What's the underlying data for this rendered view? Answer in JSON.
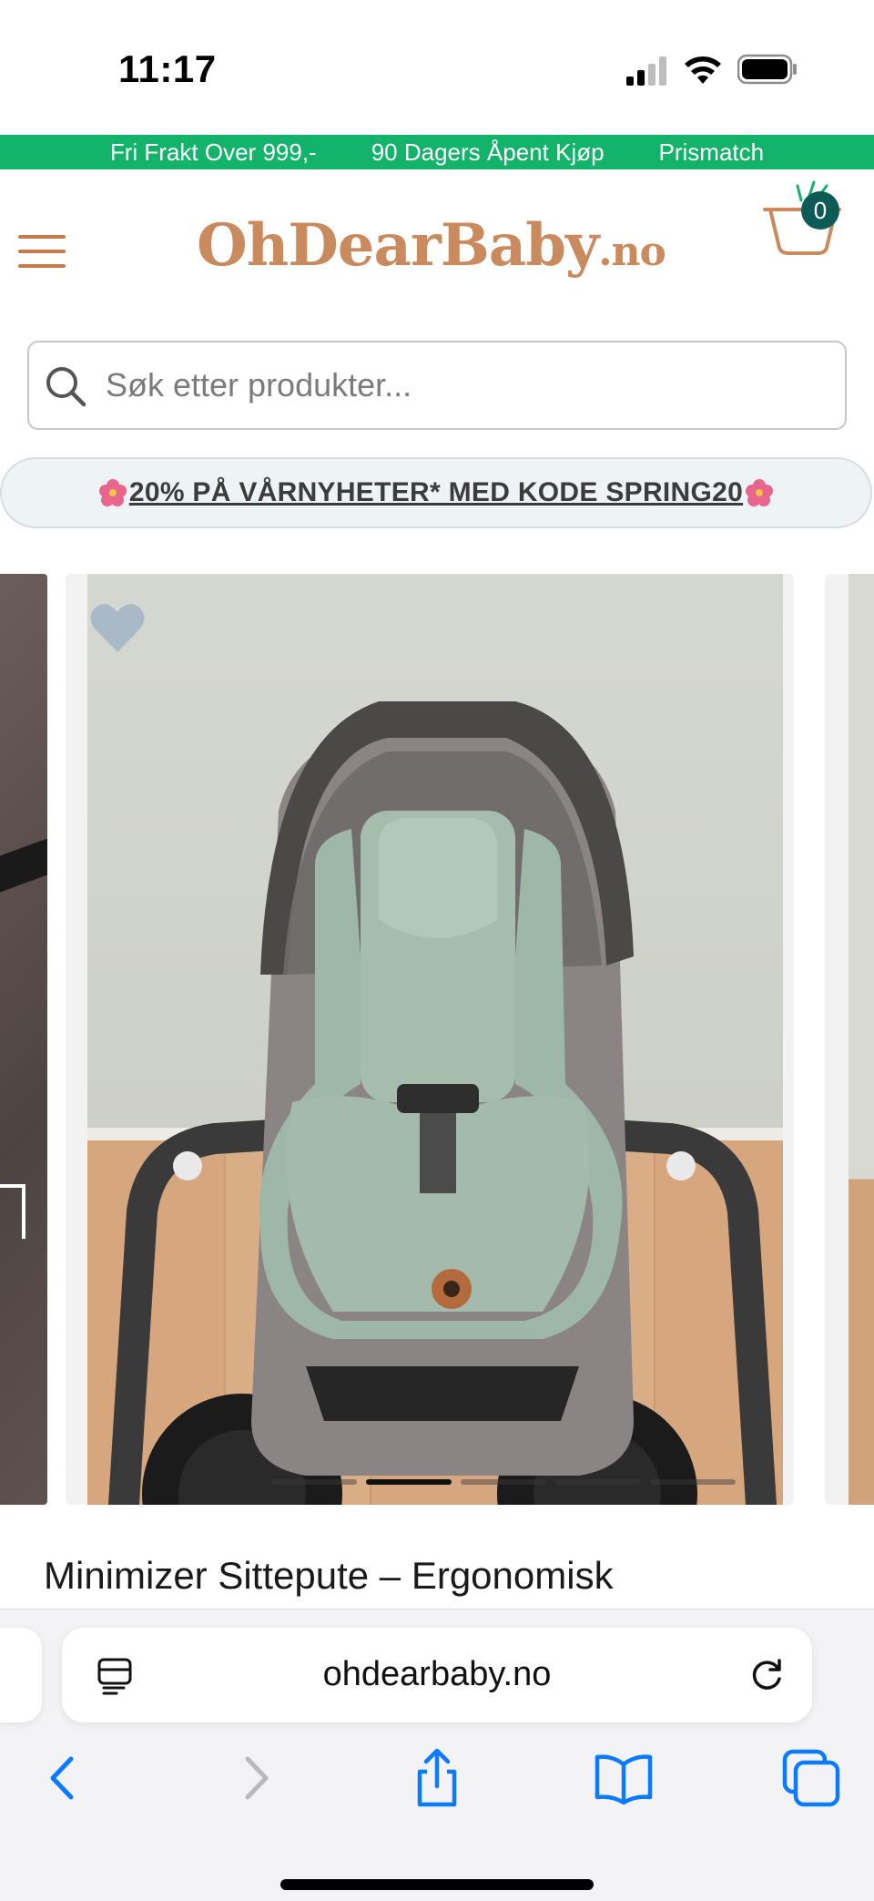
{
  "status_bar": {
    "time": "11:17"
  },
  "promo_strip": {
    "items": [
      "Fri Frakt Over 999,-",
      "90 Dagers Åpent Kjøp",
      "Prismatch"
    ]
  },
  "header": {
    "logo_main": "OhDearBaby",
    "logo_tld": ".no",
    "cart_count": "0"
  },
  "search": {
    "placeholder": "Søk etter produkter..."
  },
  "banner": {
    "text": "20% PÅ VÅRNYHETER* MED KODE SPRING20"
  },
  "gallery": {
    "dot_count": 5,
    "active_dot": 1
  },
  "product": {
    "title": "Minimizer Sittepute – Ergonomisk"
  },
  "browser": {
    "url": "ohdearbaby.no"
  },
  "colors": {
    "accent_green": "#13b36b",
    "brand_brown": "#c98a5e",
    "ios_blue": "#0a7aff",
    "badge_teal": "#0d5a57"
  },
  "icons": {
    "menu": "hamburger-icon",
    "cart": "basket-icon",
    "search": "magnifier-icon",
    "favorite": "heart-icon",
    "reader": "reader-mode-icon",
    "reload": "reload-icon",
    "back": "chevron-left-icon",
    "forward": "chevron-right-icon",
    "share": "share-icon",
    "bookmarks": "book-icon",
    "tabs": "tabs-icon"
  }
}
